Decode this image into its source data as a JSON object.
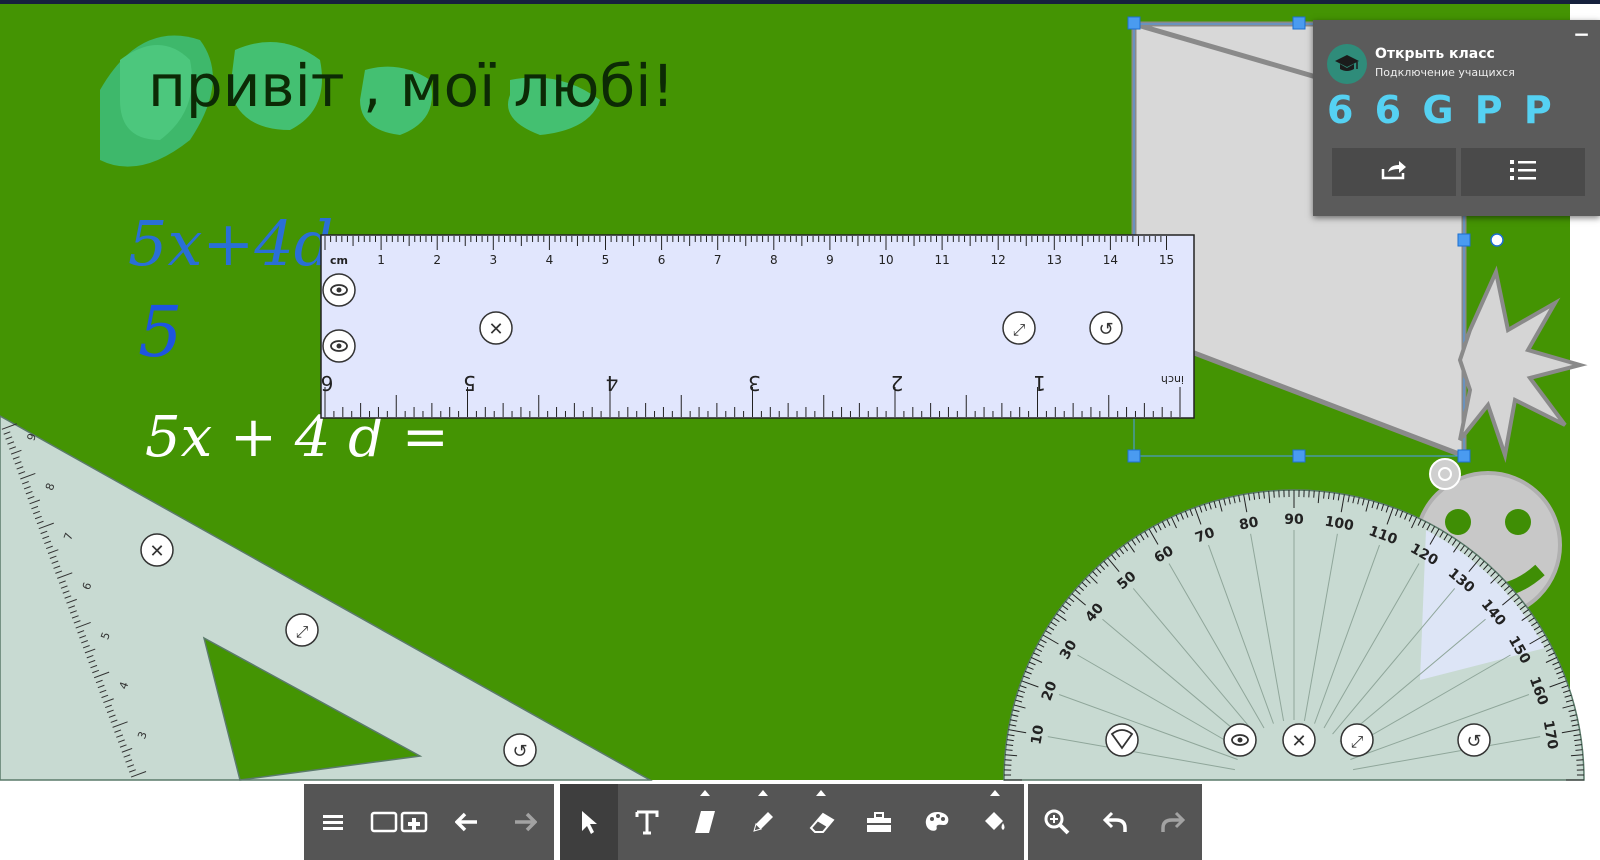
{
  "board": {
    "heading": "привіт , мої любі!",
    "handwriting": {
      "line1": "5x+4d",
      "line2": "5",
      "line3": "5x + 4 d ="
    }
  },
  "ruler": {
    "cm_unit": "cm",
    "inch_unit": "inch",
    "cm_labels": [
      "1",
      "2",
      "3",
      "4",
      "5",
      "6",
      "7",
      "8",
      "9",
      "10",
      "11",
      "12",
      "13",
      "14",
      "15"
    ],
    "inch_labels": [
      "6",
      "5",
      "4",
      "3",
      "2",
      "1"
    ]
  },
  "triangle": {
    "labels": [
      "9",
      "8",
      "7",
      "6",
      "5",
      "4",
      "3"
    ]
  },
  "protractor": {
    "labels": [
      "10",
      "20",
      "30",
      "40",
      "50",
      "60",
      "70",
      "80",
      "90",
      "100",
      "110",
      "120",
      "130",
      "140",
      "150",
      "160",
      "170"
    ]
  },
  "class_panel": {
    "title": "Открыть класс",
    "subtitle": "Подключение учащихся",
    "code": "6 6 G P P",
    "minimize_label": "−",
    "share_icon": "share-icon",
    "list_icon": "checklist-icon"
  },
  "toolbar": {
    "groups": [
      [
        {
          "name": "menu-button",
          "icon": "hamburger-icon"
        },
        {
          "name": "pages-button",
          "icon": "add-page-icon"
        },
        {
          "name": "back-button",
          "icon": "arrow-left-icon"
        },
        {
          "name": "forward-button",
          "icon": "arrow-right-icon",
          "disabled": true
        }
      ],
      [
        {
          "name": "select-tool-button",
          "icon": "cursor-icon",
          "active": true
        },
        {
          "name": "text-tool-button",
          "icon": "text-icon"
        },
        {
          "name": "shape-tool-button",
          "icon": "parallelogram-icon",
          "caret": true
        },
        {
          "name": "pen-tool-button",
          "icon": "pencil-icon",
          "caret": true
        },
        {
          "name": "eraser-tool-button",
          "icon": "eraser-icon",
          "caret": true
        },
        {
          "name": "toolbox-button",
          "icon": "toolbox-icon"
        },
        {
          "name": "color-button",
          "icon": "palette-icon"
        },
        {
          "name": "fill-tool-button",
          "icon": "paint-bucket-icon",
          "caret": true
        }
      ],
      [
        {
          "name": "zoom-button",
          "icon": "zoom-in-icon"
        },
        {
          "name": "undo-button",
          "icon": "undo-icon"
        },
        {
          "name": "redo-button",
          "icon": "redo-icon",
          "disabled": true
        }
      ]
    ]
  },
  "colors": {
    "board": "#449403",
    "toolbar": "#555555",
    "ruler": "#e1e6fd",
    "geometry_tool": "#c8dad2",
    "shape_fill": "#d8d8d8",
    "class_code": "#55d1f2"
  }
}
